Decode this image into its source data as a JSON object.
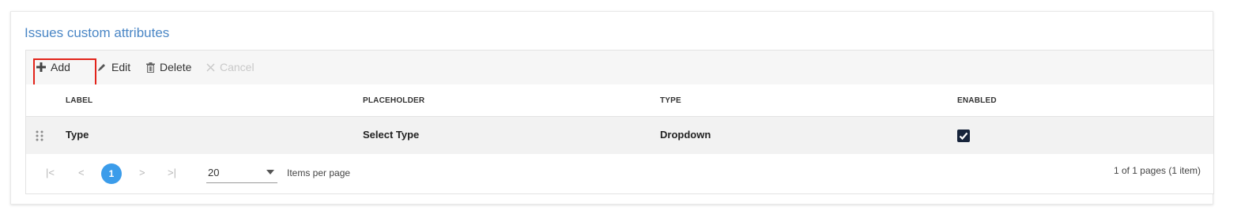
{
  "card": {
    "title": "Issues custom attributes"
  },
  "toolbar": {
    "add_label": "Add",
    "edit_label": "Edit",
    "delete_label": "Delete",
    "cancel_label": "Cancel"
  },
  "table": {
    "columns": [
      "LABEL",
      "PLACEHOLDER",
      "TYPE",
      "ENABLED"
    ],
    "rows": [
      {
        "label": "Type",
        "placeholder": "Select Type",
        "type": "Dropdown",
        "enabled": true
      }
    ]
  },
  "pager": {
    "current_page": "1",
    "page_size": "20",
    "items_per_page_label": "Items per page",
    "info": "1 of 1 pages (1 item)"
  },
  "colors": {
    "title": "#4a86c5",
    "highlight": "#e2231a",
    "page_active": "#3b9cea",
    "checkbox": "#17243b"
  }
}
